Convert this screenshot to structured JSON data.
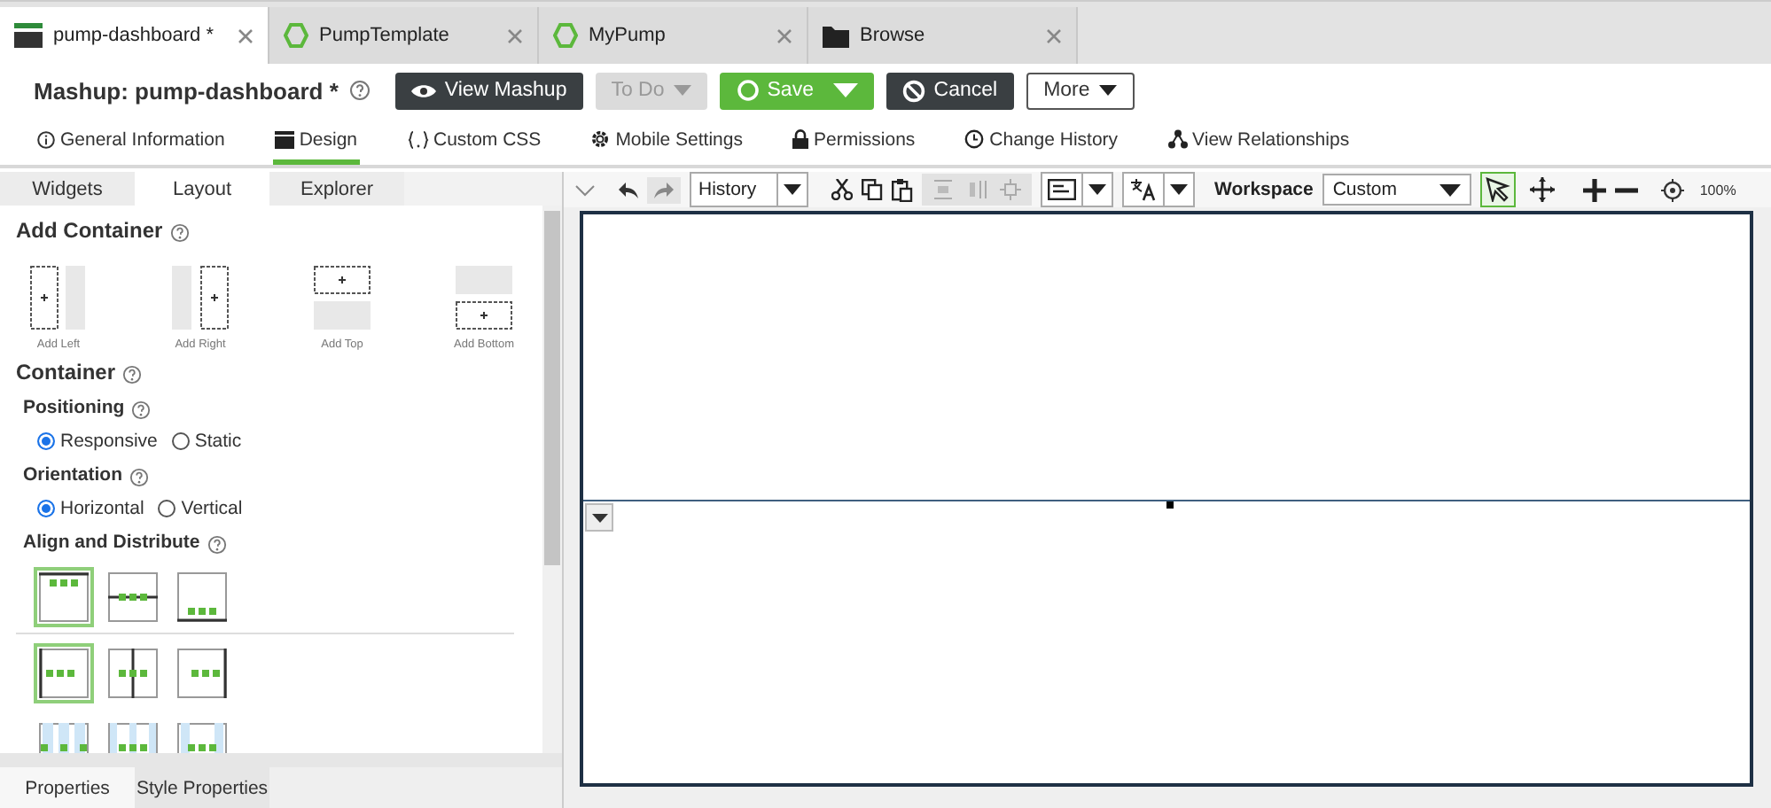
{
  "doc_tabs": [
    {
      "label": "pump-dashboard *",
      "kind": "mashup",
      "selected": true
    },
    {
      "label": "PumpTemplate",
      "kind": "thing",
      "selected": false
    },
    {
      "label": "MyPump",
      "kind": "thing",
      "selected": false
    },
    {
      "label": "Browse",
      "kind": "folder",
      "selected": false
    }
  ],
  "header": {
    "title": "Mashup: pump-dashboard *",
    "buttons": [
      {
        "label": "View Mashup",
        "kind": "view",
        "disabled": false
      },
      {
        "label": "To Do",
        "kind": "todo",
        "disabled": true
      },
      {
        "label": "Save",
        "kind": "save",
        "disabled": false
      },
      {
        "label": "Cancel",
        "kind": "cancel",
        "disabled": false
      },
      {
        "label": "More",
        "kind": "more",
        "disabled": false
      }
    ]
  },
  "nav_tabs": [
    {
      "label": "General Information",
      "kind": "info",
      "selected": false
    },
    {
      "label": "Design",
      "kind": "design",
      "selected": true
    },
    {
      "label": "Custom CSS",
      "kind": "css",
      "selected": false
    },
    {
      "label": "Mobile Settings",
      "kind": "mobile",
      "selected": false
    },
    {
      "label": "Permissions",
      "kind": "permissions",
      "selected": false
    },
    {
      "label": "Change History",
      "kind": "history",
      "selected": false
    },
    {
      "label": "View Relationships",
      "kind": "relationships",
      "selected": false
    }
  ],
  "panel_tabs": [
    {
      "label": "Widgets",
      "selected": false
    },
    {
      "label": "Layout",
      "selected": true
    },
    {
      "label": "Explorer",
      "selected": false
    }
  ],
  "layout": {
    "add_container_title": "Add Container",
    "add_options": [
      {
        "label": "Add Left",
        "kind": "left"
      },
      {
        "label": "Add Right",
        "kind": "right"
      },
      {
        "label": "Add Top",
        "kind": "top"
      },
      {
        "label": "Add Bottom",
        "kind": "bottom"
      }
    ],
    "container_title": "Container",
    "groups": [
      {
        "label": "Positioning",
        "options": [
          {
            "label": "Responsive",
            "selected": true
          },
          {
            "label": "Static",
            "selected": false
          }
        ]
      },
      {
        "label": "Orientation",
        "options": [
          {
            "label": "Horizontal",
            "selected": true
          },
          {
            "label": "Vertical",
            "selected": false
          }
        ]
      }
    ],
    "align_title": "Align and Distribute",
    "align_rows": [
      [
        {
          "kind": "top",
          "selected": true
        },
        {
          "kind": "middle",
          "selected": false
        },
        {
          "kind": "bottom",
          "selected": false
        }
      ],
      [
        {
          "kind": "left",
          "selected": true
        },
        {
          "kind": "center",
          "selected": false
        },
        {
          "kind": "right",
          "selected": false
        }
      ],
      [
        {
          "kind": "spread-around",
          "selected": false
        },
        {
          "kind": "spread-even",
          "selected": false
        },
        {
          "kind": "spread-between",
          "selected": false
        }
      ]
    ]
  },
  "bottom_tabs": [
    {
      "label": "Properties",
      "selected": true
    },
    {
      "label": "Style Properties",
      "selected": false
    }
  ],
  "toolbar": {
    "history": "History",
    "workspace_label": "Workspace",
    "workspace": "Custom",
    "zoom": "100%",
    "tools": [
      {
        "kind": "select",
        "selected": true
      },
      {
        "kind": "move",
        "selected": false
      }
    ]
  }
}
